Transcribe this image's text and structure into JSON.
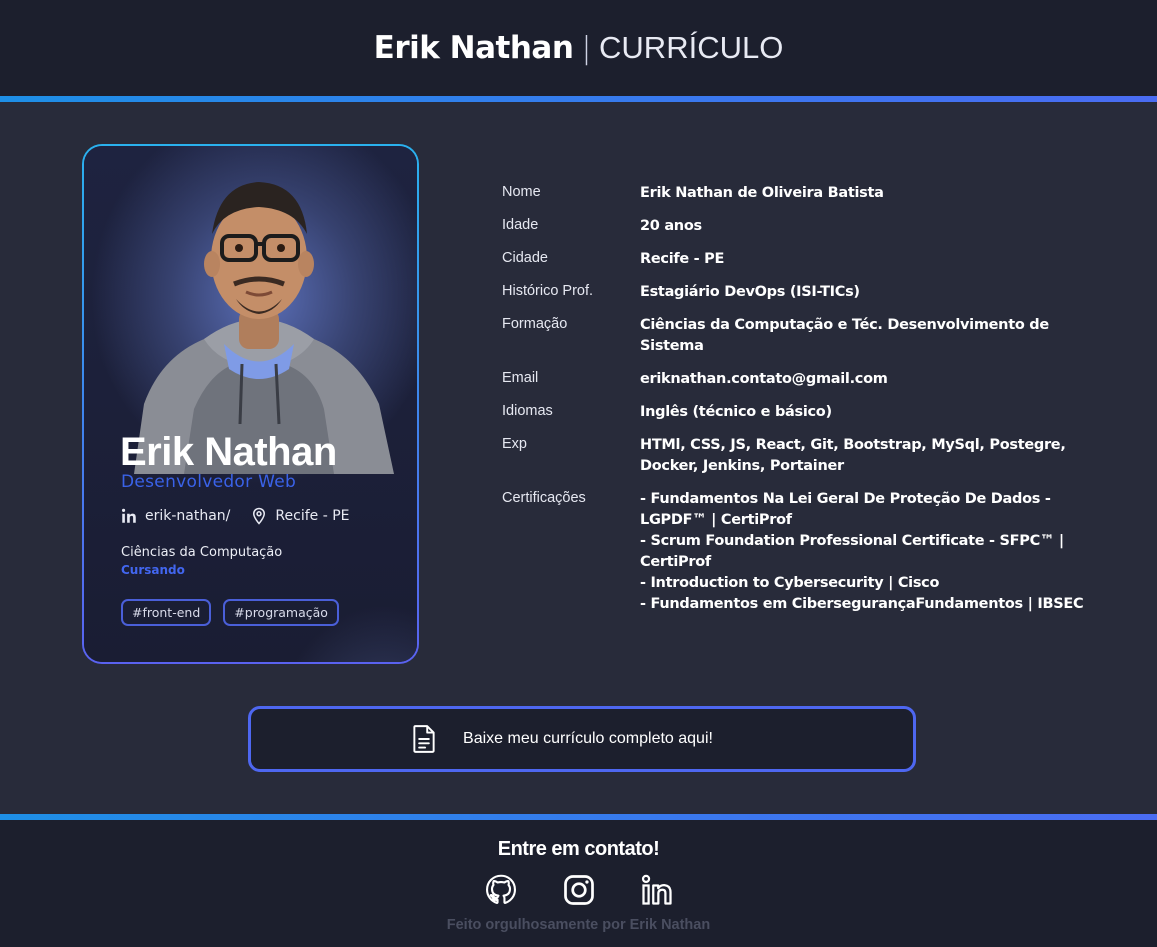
{
  "header": {
    "name": "Erik Nathan",
    "separator": "|",
    "subtitle": "CURRÍCULO"
  },
  "card": {
    "name": "Erik Nathan",
    "role": "Desenvolvedor Web",
    "linkedin": "erik-nathan/",
    "location": "Recife - PE",
    "course": "Ciências da Computação",
    "status": "Cursando",
    "tags": [
      "#front-end",
      "#programação"
    ]
  },
  "info": [
    {
      "label": "Nome",
      "lines": [
        "Erik Nathan de Oliveira Batista"
      ]
    },
    {
      "label": "Idade",
      "lines": [
        "20 anos"
      ]
    },
    {
      "label": "Cidade",
      "lines": [
        "Recife - PE"
      ]
    },
    {
      "label": "Histórico Prof.",
      "lines": [
        "Estagiário DevOps (ISI-TICs)"
      ]
    },
    {
      "label": "Formação",
      "lines": [
        "Ciências da Computação e Téc. Desenvolvimento de",
        "Sistema"
      ]
    },
    {
      "label": "Email",
      "lines": [
        "eriknathan.contato@gmail.com"
      ]
    },
    {
      "label": "Idiomas",
      "lines": [
        "Inglês (técnico e básico)"
      ]
    },
    {
      "label": "Exp",
      "lines": [
        "HTMl, CSS, JS, React, Git, Bootstrap, MySql, Postegre,",
        "Docker, Jenkins, Portainer"
      ]
    },
    {
      "label": "Certificações",
      "lines": [
        "- Fundamentos Na Lei Geral De Proteção De Dados -",
        "LGPDF™ | CertiProf",
        "- Scrum Foundation Professional Certificate - SFPC™ |",
        "CertiProf",
        "- Introduction to Cybersecurity | Cisco",
        "- Fundamentos em CibersegurançaFundamentos | IBSEC"
      ]
    }
  ],
  "download": {
    "label": "Baixe meu currículo completo aqui!",
    "icon": "document-icon"
  },
  "footer": {
    "title": "Entre em contato!",
    "socials": [
      "github-icon",
      "instagram-icon",
      "linkedin-icon"
    ],
    "credit": "Feito orgulhosamente por Erik Nathan"
  },
  "colors": {
    "accent": "#4e67f0",
    "gradient_start": "#1e8fe6",
    "background": "#282b3a",
    "bar": "#1c1f2d"
  }
}
